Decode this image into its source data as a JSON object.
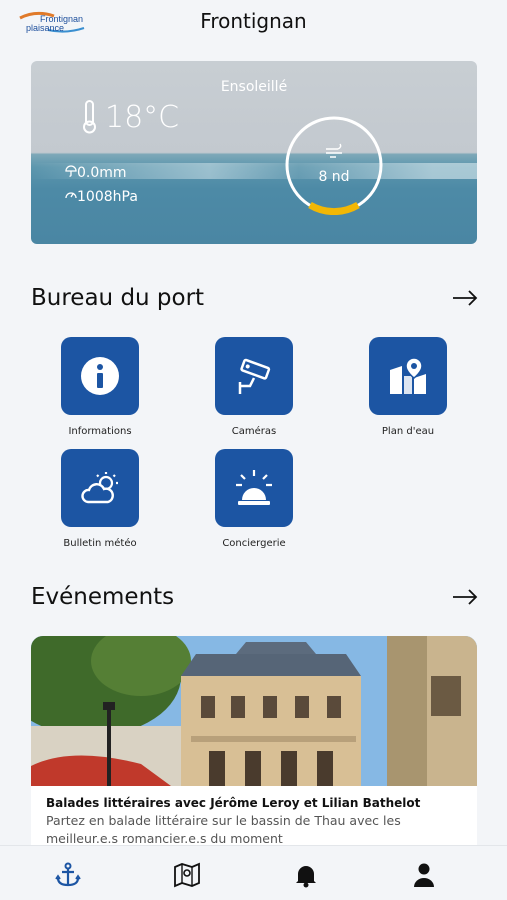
{
  "header": {
    "logo_line1": "Frontignan",
    "logo_line2": "plaisance",
    "title": "Frontignan"
  },
  "weather": {
    "condition": "Ensoleillé",
    "temperature": "18°C",
    "rain": "0.0mm",
    "pressure": "1008hPa",
    "wind": "8 nd"
  },
  "harbor": {
    "title": "Bureau du port",
    "tiles": [
      {
        "label": "Informations"
      },
      {
        "label": "Caméras"
      },
      {
        "label": "Plan d'eau"
      },
      {
        "label": "Bulletin météo"
      },
      {
        "label": "Conciergerie"
      }
    ]
  },
  "events": {
    "title": "Evénements",
    "card": {
      "title": "Balades littéraires avec Jérôme Leroy et Lilian Bathelot",
      "description": "Partez en balade littéraire sur le bassin de Thau avec les meilleur.e.s romancier.e.s du moment"
    }
  },
  "colors": {
    "accent": "#1c55a3",
    "gauge": "#f2b705"
  }
}
